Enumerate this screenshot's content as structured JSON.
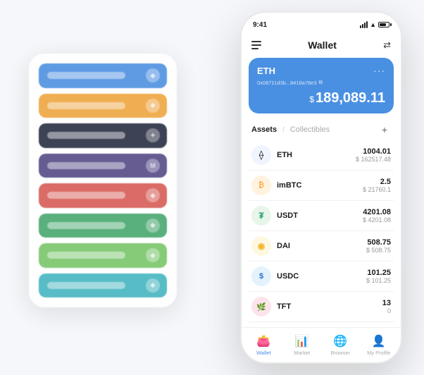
{
  "scene": {
    "left_card": {
      "rows": [
        {
          "color": "row-blue",
          "icon": "◆"
        },
        {
          "color": "row-orange",
          "icon": "◆"
        },
        {
          "color": "row-dark",
          "icon": "✦"
        },
        {
          "color": "row-purple",
          "icon": "M"
        },
        {
          "color": "row-red",
          "icon": "◆"
        },
        {
          "color": "row-green",
          "icon": "◆"
        },
        {
          "color": "row-lightgreen",
          "icon": "◆"
        },
        {
          "color": "row-teal",
          "icon": "◆"
        }
      ]
    },
    "phone": {
      "status_bar": {
        "time": "9:41"
      },
      "nav_header": {
        "title": "Wallet"
      },
      "eth_card": {
        "token": "ETH",
        "address": "0x08711d3b...8418a78e3",
        "balance_symbol": "$",
        "balance": "189,089.11"
      },
      "assets_section": {
        "tab_active": "Assets",
        "tab_divider": "/",
        "tab_inactive": "Collectibles",
        "add_button": "+"
      },
      "assets": [
        {
          "name": "ETH",
          "icon": "⟠",
          "icon_class": "asset-icon-eth",
          "amount": "1004.01",
          "usd": "$ 162517.48"
        },
        {
          "name": "imBTC",
          "icon": "₿",
          "icon_class": "asset-icon-imbtc",
          "amount": "2.5",
          "usd": "$ 21760.1"
        },
        {
          "name": "USDT",
          "icon": "₮",
          "icon_class": "asset-icon-usdt",
          "amount": "4201.08",
          "usd": "$ 4201.08"
        },
        {
          "name": "DAI",
          "icon": "◈",
          "icon_class": "asset-icon-dai",
          "amount": "508.75",
          "usd": "$ 508.75"
        },
        {
          "name": "USDC",
          "icon": "$",
          "icon_class": "asset-icon-usdc",
          "amount": "101.25",
          "usd": "$ 101.25"
        },
        {
          "name": "TFT",
          "icon": "🌿",
          "icon_class": "asset-icon-tft",
          "amount": "13",
          "usd": "0"
        }
      ],
      "bottom_nav": {
        "items": [
          {
            "icon": "👛",
            "label": "Wallet",
            "active": true
          },
          {
            "icon": "📈",
            "label": "Market",
            "active": false
          },
          {
            "icon": "🌐",
            "label": "Browser",
            "active": false
          },
          {
            "icon": "👤",
            "label": "My Profile",
            "active": false
          }
        ]
      }
    }
  }
}
